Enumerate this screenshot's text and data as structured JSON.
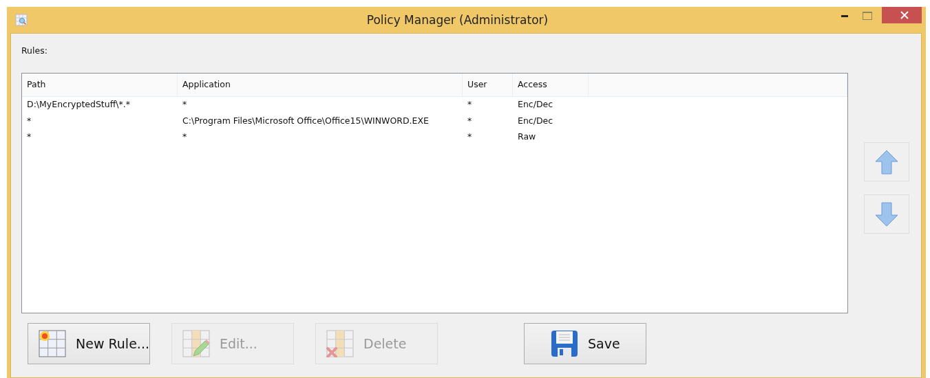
{
  "window": {
    "title": "Policy Manager (Administrator)"
  },
  "rules_label": "Rules:",
  "table": {
    "columns": [
      "Path",
      "Application",
      "User",
      "Access"
    ],
    "rows": [
      [
        "D:\\MyEncryptedStuff\\*.*",
        "*",
        "*",
        "Enc/Dec"
      ],
      [
        "*",
        "C:\\Program Files\\Microsoft Office\\Office15\\WINWORD.EXE",
        "*",
        "Enc/Dec"
      ],
      [
        "*",
        "*",
        "*",
        "Raw"
      ]
    ]
  },
  "move_buttons": [
    {
      "kind": "up",
      "disabled": false
    },
    {
      "kind": "down",
      "disabled": false
    }
  ],
  "buttons": [
    {
      "kind": "new",
      "label": "New Rule...",
      "disabled": false
    },
    {
      "kind": "edit",
      "label": "Edit...",
      "disabled": true
    },
    {
      "kind": "delete",
      "label": "Delete",
      "disabled": true
    },
    {
      "kind": "save",
      "label": "Save",
      "disabled": false
    }
  ]
}
